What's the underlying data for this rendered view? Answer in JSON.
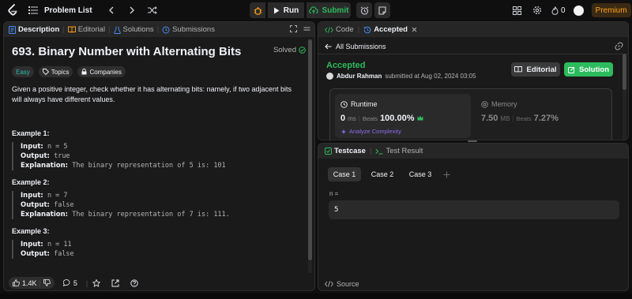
{
  "topbar": {
    "problem_list": "Problem List",
    "run": "Run",
    "submit": "Submit",
    "streak": "0",
    "premium": "Premium"
  },
  "left": {
    "tabs": [
      "Description",
      "Editorial",
      "Solutions",
      "Submissions"
    ],
    "title": "693. Binary Number with Alternating Bits",
    "solved": "Solved",
    "tags": [
      "Easy",
      "Topics",
      "Companies"
    ],
    "description": "Given a positive integer, check whether it has alternating bits: namely, if two adjacent bits will always have different values.",
    "examples": [
      {
        "heading": "Example 1:",
        "input": "n = 5",
        "output": "true",
        "explanation": "The binary representation of 5 is: 101"
      },
      {
        "heading": "Example 2:",
        "input": "n = 7",
        "output": "false",
        "explanation": "The binary representation of 7 is: 111."
      },
      {
        "heading": "Example 3:",
        "input": "n = 11",
        "output": "false"
      }
    ],
    "labels": {
      "input": "Input:",
      "output": "Output:",
      "explanation": "Explanation:"
    },
    "likes": "1.4K",
    "comments": "5"
  },
  "result": {
    "tabs": [
      "Code",
      "Accepted"
    ],
    "all_submissions": "All Submissions",
    "status": "Accepted",
    "author": "Abdur Rahman",
    "submitted": "submitted at Aug 02, 2024 03:05",
    "editorial": "Editorial",
    "solution": "Solution",
    "runtime_label": "Runtime",
    "runtime_value": "0",
    "runtime_unit": "ms",
    "beats_label": "Beats",
    "runtime_beats": "100.00%",
    "analyze": "Analyze Complexity",
    "memory_label": "Memory",
    "memory_value": "7.50",
    "memory_unit": "MB",
    "memory_beats": "7.27%"
  },
  "testcase": {
    "tabs": [
      "Testcase",
      "Test Result"
    ],
    "cases": [
      "Case 1",
      "Case 2",
      "Case 3"
    ],
    "var_label": "n =",
    "var_value": "5",
    "source": "Source"
  },
  "colors": {
    "accent": "#ffa116",
    "green": "#2cbb5d",
    "easy": "#2cbcb1",
    "bg": "#0f0f0f",
    "panel": "#1a1a1a"
  }
}
